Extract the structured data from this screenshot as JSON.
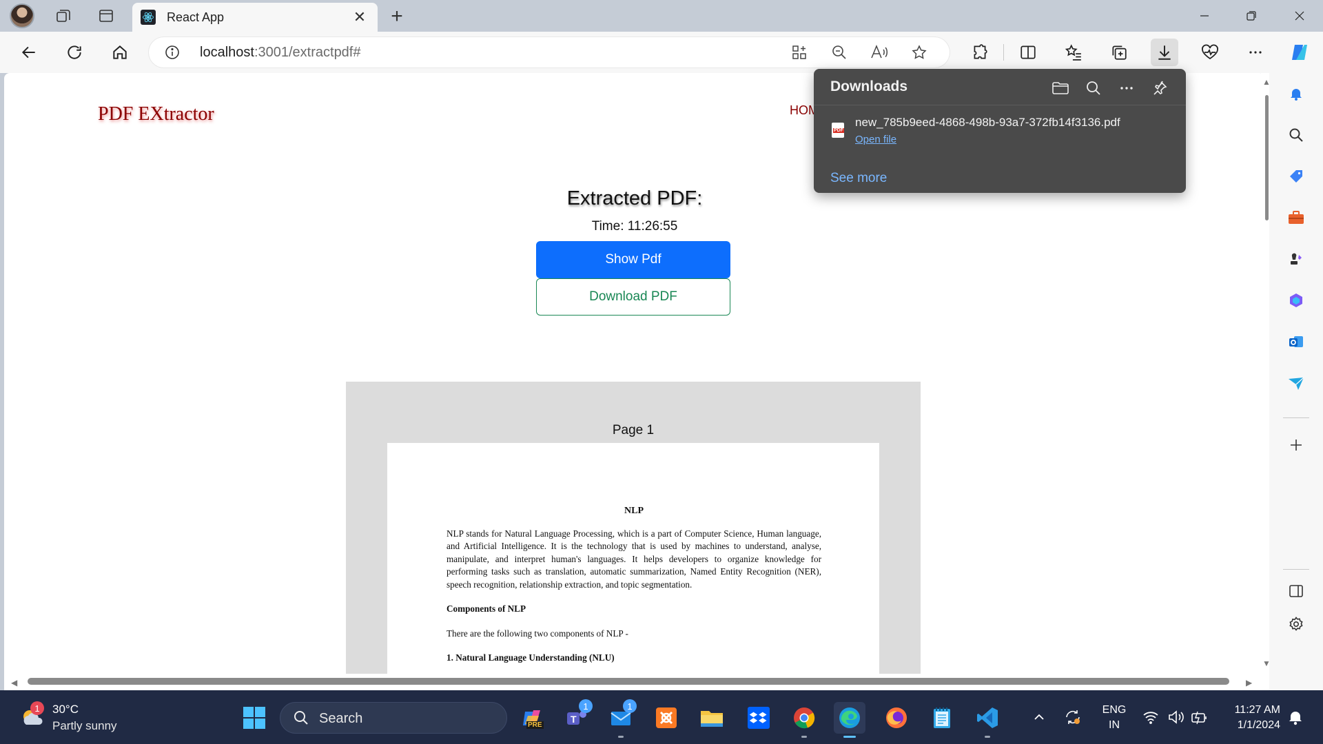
{
  "browser": {
    "tab": {
      "title": "React App",
      "close_symbol": "✕"
    },
    "new_tab_symbol": "+",
    "address": {
      "host": "localhost",
      "path": ":3001/extractpdf#"
    }
  },
  "page": {
    "brand": "PDF EXtractor",
    "nav_home": "HOME",
    "heading": "Extracted PDF:",
    "time_label": "Time: 11:26:55",
    "show_button": "Show Pdf",
    "download_button": "Download PDF",
    "viewer": {
      "page_label": "Page 1",
      "doc_title": "NLP",
      "paragraph1": "NLP stands for Natural Language Processing, which is a part of Computer Science, Human language, and Artificial Intelligence. It is the technology that is used by machines to understand, analyse, manipulate, and interpret human's languages. It helps developers to organize knowledge for performing tasks such as translation, automatic summarization, Named Entity Recognition (NER), speech recognition, relationship extraction, and topic segmentation.",
      "subheading": "Components of NLP",
      "paragraph2": "There are the following two components of NLP -",
      "section1": "1. Natural Language Understanding (NLU)"
    }
  },
  "downloads": {
    "title": "Downloads",
    "file_name": "new_785b9eed-4868-498b-93a7-372fb14f3136.pdf",
    "file_badge": "PDF",
    "open_file": "Open file",
    "see_more": "See more"
  },
  "taskbar": {
    "weather_temp": "30°C",
    "weather_desc": "Partly sunny",
    "weather_badge": "1",
    "search_label": "Search",
    "teams_badge": "1",
    "mail_badge": "1",
    "copilot_badge": "PRE",
    "lang_line1": "ENG",
    "lang_line2": "IN",
    "time": "11:27 AM",
    "date": "1/1/2024"
  },
  "colors": {
    "accent_blue": "#0d6efd",
    "success_green": "#198754",
    "brand_red": "#8b0000",
    "taskbar_bg": "#202a44",
    "flyout_bg": "#4a4a4a"
  }
}
